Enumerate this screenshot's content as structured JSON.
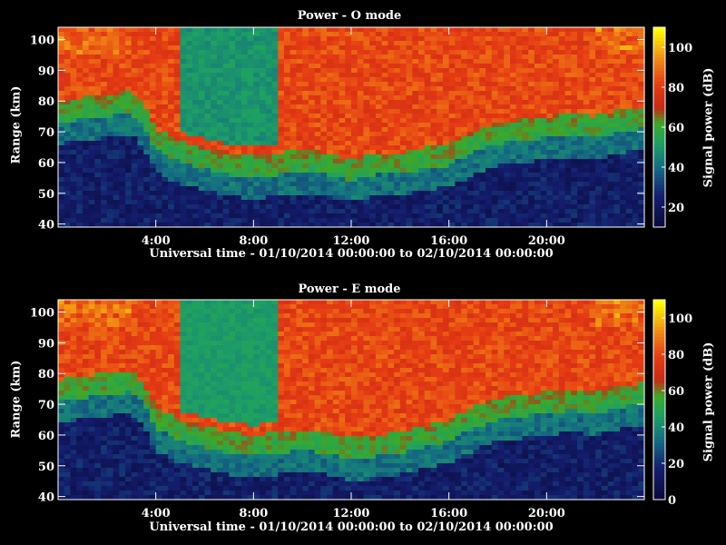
{
  "chart_data": [
    {
      "type": "heatmap",
      "title": "Power - O mode",
      "xlabel": "Universal time - 01/10/2014 00:00:00 to 02/10/2014 00:00:00",
      "ylabel": "Range (km)",
      "colorbar_label": "Signal power (dB)",
      "x_ticks": [
        "4:00",
        "8:00",
        "12:00",
        "16:00",
        "20:00"
      ],
      "x_tick_hours": [
        4,
        8,
        12,
        16,
        20
      ],
      "xlim_hours": [
        0,
        24
      ],
      "y_ticks": [
        40,
        50,
        60,
        70,
        80,
        90,
        100
      ],
      "ylim": [
        39,
        104
      ],
      "colorbar_ticks": [
        20,
        40,
        60,
        80,
        100
      ],
      "colorbar_range": [
        10,
        110
      ],
      "boundary_km": [
        [
          0,
          77
        ],
        [
          1,
          78
        ],
        [
          2,
          79
        ],
        [
          3,
          80
        ],
        [
          3.5,
          76
        ],
        [
          4,
          68
        ],
        [
          5,
          64
        ],
        [
          6,
          62
        ],
        [
          7,
          60
        ],
        [
          8,
          59
        ],
        [
          9,
          60
        ],
        [
          10,
          61
        ],
        [
          11,
          60
        ],
        [
          12,
          58
        ],
        [
          13,
          60
        ],
        [
          14,
          60
        ],
        [
          15,
          62
        ],
        [
          16,
          63
        ],
        [
          17,
          67
        ],
        [
          18,
          70
        ],
        [
          19,
          71
        ],
        [
          20,
          72
        ],
        [
          21,
          73
        ],
        [
          22,
          72
        ],
        [
          23,
          74
        ],
        [
          24,
          75
        ]
      ]
    },
    {
      "type": "heatmap",
      "title": "Power - E mode",
      "xlabel": "Universal time - 01/10/2014 00:00:00 to 02/10/2014 00:00:00",
      "ylabel": "Range (km)",
      "colorbar_label": "Signal power (dB)",
      "x_ticks": [
        "4:00",
        "8:00",
        "12:00",
        "16:00",
        "20:00"
      ],
      "x_tick_hours": [
        4,
        8,
        12,
        16,
        20
      ],
      "xlim_hours": [
        0,
        24
      ],
      "y_ticks": [
        40,
        50,
        60,
        70,
        80,
        90,
        100
      ],
      "ylim": [
        39,
        104
      ],
      "colorbar_ticks": [
        0,
        20,
        40,
        60,
        80,
        100
      ],
      "colorbar_range": [
        0,
        110
      ],
      "boundary_km": [
        [
          0,
          75
        ],
        [
          1,
          76
        ],
        [
          2,
          77
        ],
        [
          3,
          78
        ],
        [
          3.5,
          74
        ],
        [
          4,
          66
        ],
        [
          5,
          62
        ],
        [
          6,
          60
        ],
        [
          7,
          58
        ],
        [
          8,
          57
        ],
        [
          9,
          58
        ],
        [
          10,
          59
        ],
        [
          11,
          58
        ],
        [
          12,
          56
        ],
        [
          13,
          57
        ],
        [
          14,
          58
        ],
        [
          15,
          60
        ],
        [
          16,
          62
        ],
        [
          17,
          66
        ],
        [
          18,
          69
        ],
        [
          19,
          70
        ],
        [
          20,
          71
        ],
        [
          21,
          72
        ],
        [
          22,
          71
        ],
        [
          23,
          73
        ],
        [
          24,
          74
        ]
      ]
    }
  ]
}
